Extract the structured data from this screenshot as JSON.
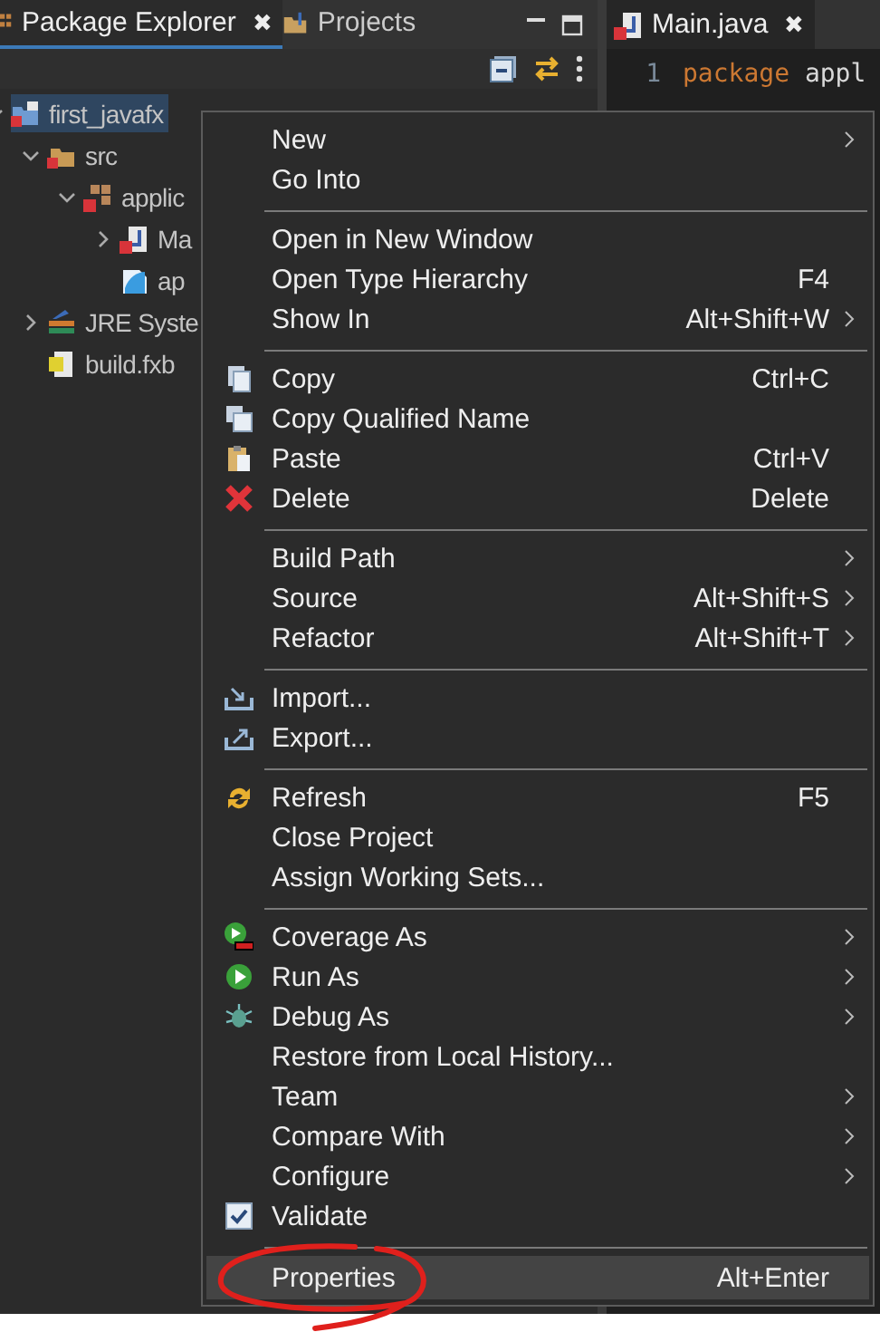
{
  "left_panel": {
    "tabs": [
      {
        "label": "Package Explorer",
        "selected": true,
        "close": "✖",
        "kind": "explorer"
      },
      {
        "label": "Projects",
        "selected": false,
        "kind": "projects"
      }
    ],
    "tree": [
      {
        "label": "first_javafx",
        "kind": "project",
        "expanded": true,
        "selected": true,
        "children": [
          {
            "label": "src",
            "kind": "source-folder",
            "expanded": true,
            "selected": false,
            "children": [
              {
                "label": "applic",
                "kind": "package",
                "expanded": true,
                "selected": false,
                "children": [
                  {
                    "label": "Ma",
                    "kind": "java",
                    "expanded": false,
                    "selected": false
                  },
                  {
                    "label": "ap",
                    "kind": "fxml",
                    "selected": false
                  }
                ]
              }
            ]
          },
          {
            "label": "JRE Syste",
            "kind": "library",
            "expanded": false,
            "selected": false
          },
          {
            "label": "build.fxb",
            "kind": "build",
            "selected": false
          }
        ]
      }
    ]
  },
  "editor": {
    "tabs": [
      {
        "label": "Main.java",
        "selected": true,
        "close": "✖"
      }
    ],
    "lines": [
      {
        "number": "1",
        "code": [
          {
            "kind": "keyword",
            "text": "package"
          },
          {
            "kind": "plain",
            "text": "appl"
          }
        ]
      }
    ]
  },
  "context_menu": {
    "groups": [
      [
        {
          "label": "New",
          "submenu": true,
          "selected": false
        },
        {
          "label": "Go Into",
          "submenu": false,
          "selected": false
        }
      ],
      [
        {
          "label": "Open in New Window",
          "submenu": false,
          "selected": false
        },
        {
          "label": "Open Type Hierarchy",
          "shortcut": "F4",
          "submenu": false,
          "selected": false
        },
        {
          "label": "Show In",
          "shortcut": "Alt+Shift+W",
          "submenu": true,
          "selected": false
        }
      ],
      [
        {
          "label": "Copy",
          "shortcut": "Ctrl+C",
          "kind": "copy",
          "submenu": false,
          "selected": false
        },
        {
          "label": "Copy Qualified Name",
          "kind": "copy-name",
          "submenu": false,
          "selected": false
        },
        {
          "label": "Paste",
          "shortcut": "Ctrl+V",
          "kind": "paste",
          "submenu": false,
          "selected": false
        },
        {
          "label": "Delete",
          "shortcut": "Delete",
          "kind": "delete",
          "submenu": false,
          "selected": false
        }
      ],
      [
        {
          "label": "Build Path",
          "submenu": true,
          "selected": false
        },
        {
          "label": "Source",
          "shortcut": "Alt+Shift+S",
          "submenu": true,
          "selected": false
        },
        {
          "label": "Refactor",
          "shortcut": "Alt+Shift+T",
          "submenu": true,
          "selected": false
        }
      ],
      [
        {
          "label": "Import...",
          "kind": "import",
          "submenu": false,
          "selected": false
        },
        {
          "label": "Export...",
          "kind": "export",
          "submenu": false,
          "selected": false
        }
      ],
      [
        {
          "label": "Refresh",
          "shortcut": "F5",
          "kind": "refresh",
          "submenu": false,
          "selected": false
        },
        {
          "label": "Close Project",
          "submenu": false,
          "selected": false
        },
        {
          "label": "Assign Working Sets...",
          "submenu": false,
          "selected": false
        }
      ],
      [
        {
          "label": "Coverage As",
          "kind": "coverage",
          "submenu": true,
          "selected": false
        },
        {
          "label": "Run As",
          "kind": "run",
          "submenu": true,
          "selected": false
        },
        {
          "label": "Debug As",
          "kind": "debug",
          "submenu": true,
          "selected": false
        },
        {
          "label": "Restore from Local History...",
          "submenu": false,
          "selected": false
        },
        {
          "label": "Team",
          "submenu": true,
          "selected": false
        },
        {
          "label": "Compare With",
          "submenu": true,
          "selected": false
        },
        {
          "label": "Configure",
          "submenu": true,
          "selected": false
        },
        {
          "label": "Validate",
          "kind": "check",
          "submenu": false,
          "selected": false
        }
      ],
      [
        {
          "label": "Properties",
          "shortcut": "Alt+Enter",
          "submenu": false,
          "selected": true
        }
      ]
    ]
  }
}
